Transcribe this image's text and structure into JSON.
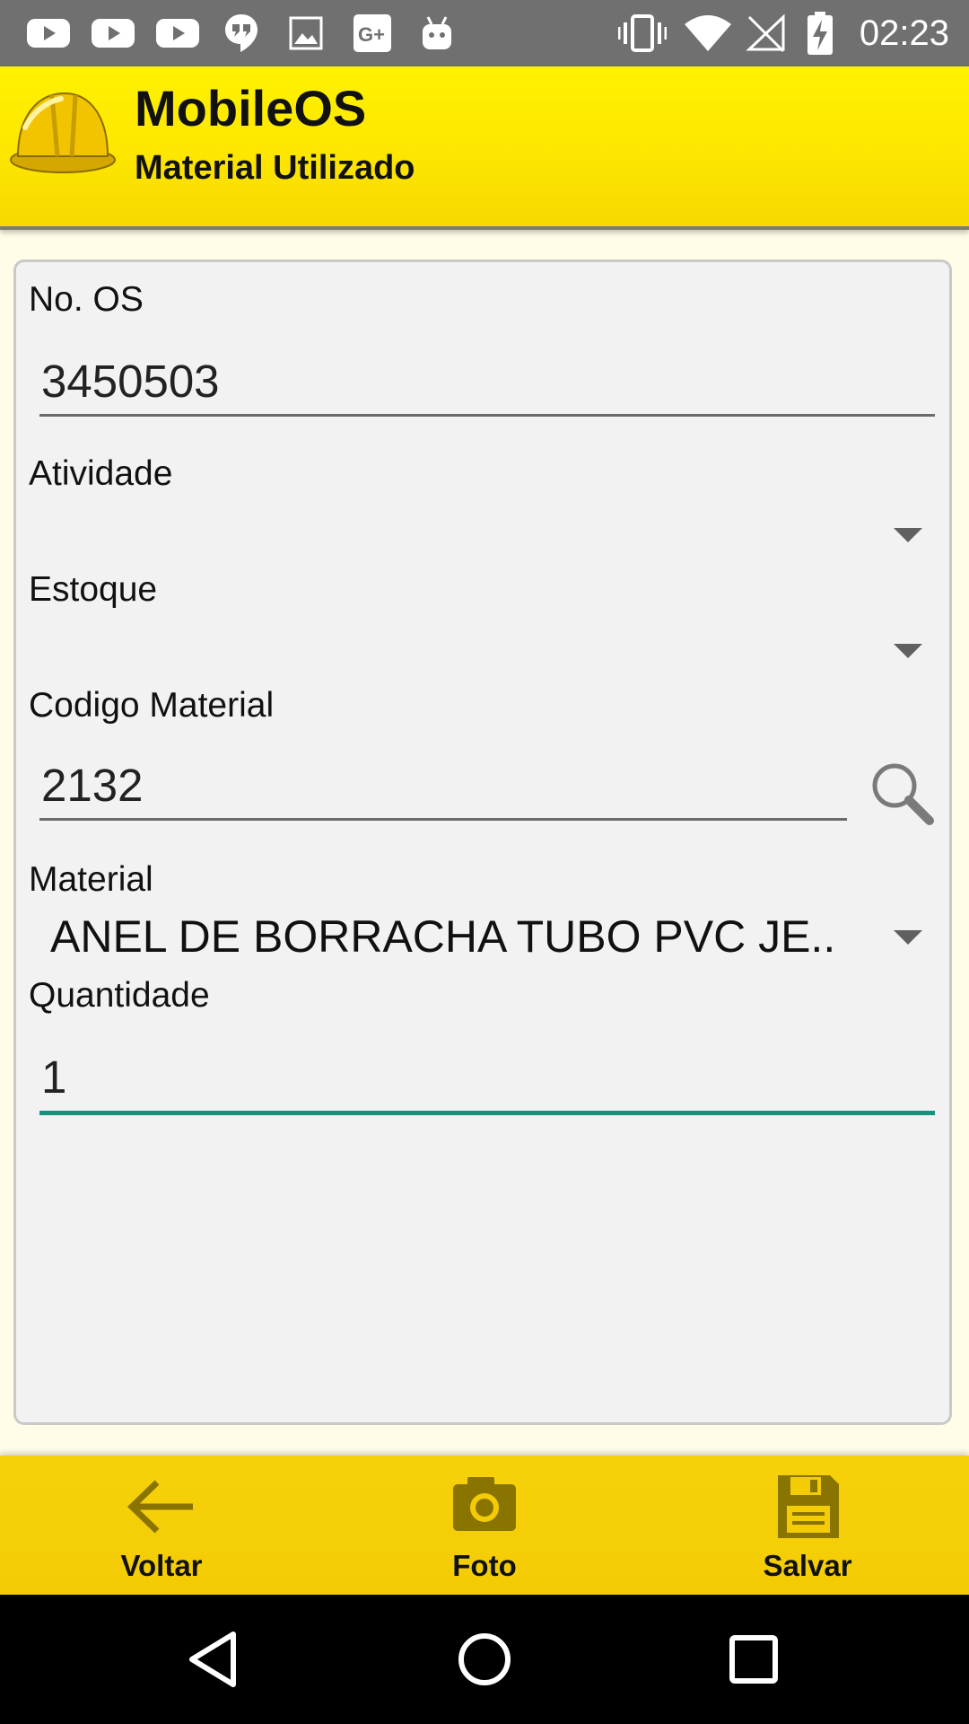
{
  "status_bar": {
    "time": "02:23",
    "notification_icons": [
      "youtube-icon",
      "youtube-icon",
      "youtube-icon",
      "hangouts-icon",
      "image-icon",
      "google-plus-icon",
      "android-icon"
    ],
    "system_icons": [
      "vibrate-icon",
      "wifi-icon",
      "no-signal-icon",
      "battery-charging-icon"
    ]
  },
  "header": {
    "title": "MobileOS",
    "subtitle": "Material Utilizado",
    "logo_icon": "hard-hat-icon",
    "background_color": "#fde600"
  },
  "form": {
    "no_os": {
      "label": "No. OS",
      "value": "3450503"
    },
    "atividade": {
      "label": "Atividade",
      "value": ""
    },
    "estoque": {
      "label": "Estoque",
      "value": ""
    },
    "codigo_material": {
      "label": "Codigo Material",
      "value": "2132",
      "search_icon": "search-icon"
    },
    "material": {
      "label": "Material",
      "value": "ANEL DE BORRACHA TUBO PVC JE.."
    },
    "quantidade": {
      "label": "Quantidade",
      "value": "1"
    },
    "focus_color": "#15917e"
  },
  "bottom_bar": {
    "background_color": "#f3cc05",
    "buttons": [
      {
        "label": "Voltar",
        "icon": "arrow-left-icon"
      },
      {
        "label": "Foto",
        "icon": "camera-icon"
      },
      {
        "label": "Salvar",
        "icon": "floppy-disk-icon"
      }
    ]
  },
  "nav_bar": {
    "buttons": [
      "back-icon",
      "home-icon",
      "recents-icon"
    ]
  }
}
